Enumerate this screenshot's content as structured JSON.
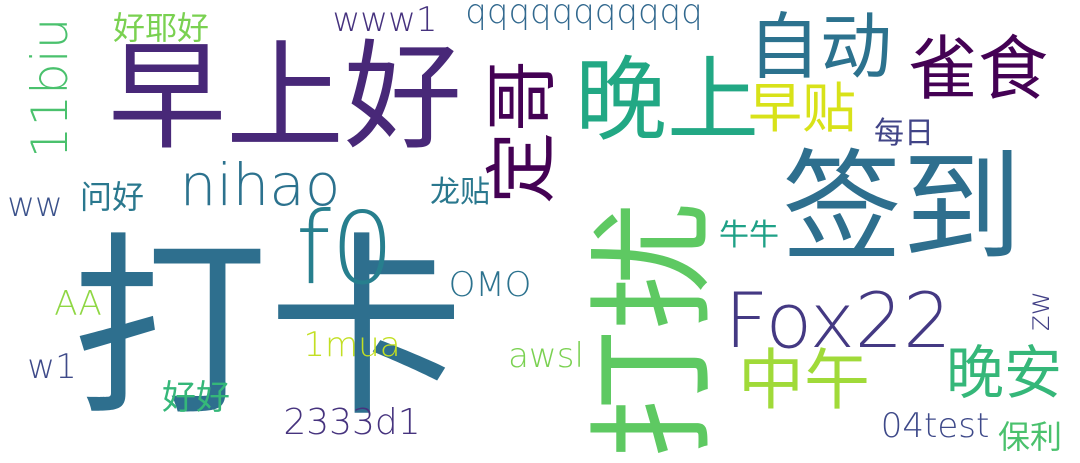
{
  "words": [
    {
      "id": "dakai",
      "text": "打卡",
      "color": "#2e6f8e"
    },
    {
      "id": "zaoshanghao",
      "text": "早上好",
      "color": "#482878"
    },
    {
      "id": "qiandao",
      "text": "签到",
      "color": "#2e6f8e"
    },
    {
      "id": "darao",
      "text": "打扰",
      "color": "#5ec962"
    },
    {
      "id": "wanshang",
      "text": "晚上",
      "color": "#22a884"
    },
    {
      "id": "fox22",
      "text": "Fox22",
      "color": "#443983"
    },
    {
      "id": "f0",
      "text": "f0",
      "color": "#277f8e"
    },
    {
      "id": "zidong",
      "text": "自动",
      "color": "#2c728e"
    },
    {
      "id": "queshi",
      "text": "雀食",
      "color": "#440154"
    },
    {
      "id": "nihao",
      "text": "nihao",
      "color": "#2c728e"
    },
    {
      "id": "zhongwu",
      "text": "中午",
      "color": "#a0da39"
    },
    {
      "id": "wanan",
      "text": "晚安",
      "color": "#35b779"
    },
    {
      "id": "zaotie",
      "text": "早贴",
      "color": "#d8e219"
    },
    {
      "id": "dingqing",
      "text": "定哥",
      "color": "#440154"
    },
    {
      "id": "11biu",
      "text": "11biu",
      "color": "#4ac16d"
    },
    {
      "id": "qqq",
      "text": "qqqqqqqqqqq",
      "color": "#31688e"
    },
    {
      "id": "www1",
      "text": "www1",
      "color": "#46327e"
    },
    {
      "id": "haoyehao",
      "text": "好耶好",
      "color": "#7ad151"
    },
    {
      "id": "meiri",
      "text": "每日",
      "color": "#414487"
    },
    {
      "id": "longtie",
      "text": "龙贴",
      "color": "#2a788e"
    },
    {
      "id": "ww",
      "text": "ww",
      "color": "#3b528b"
    },
    {
      "id": "wenhao",
      "text": "问好",
      "color": "#2a788e"
    },
    {
      "id": "niuniu",
      "text": "牛牛",
      "color": "#1fa187"
    },
    {
      "id": "omo",
      "text": "OMO",
      "color": "#2c728e"
    },
    {
      "id": "aa",
      "text": "AA",
      "color": "#8fd744"
    },
    {
      "id": "1mua",
      "text": "1mua",
      "color": "#c2df23"
    },
    {
      "id": "awsl",
      "text": "awsl",
      "color": "#7ad151"
    },
    {
      "id": "w1",
      "text": "w1",
      "color": "#3e4a89"
    },
    {
      "id": "haohao",
      "text": "好好",
      "color": "#35b779"
    },
    {
      "id": "2333d1",
      "text": "2333d1",
      "color": "#46337e"
    },
    {
      "id": "04test",
      "text": "04test",
      "color": "#3e4989"
    },
    {
      "id": "baoli",
      "text": "保利",
      "color": "#4ac16d"
    },
    {
      "id": "zw",
      "text": "zw",
      "color": "#424086"
    }
  ]
}
